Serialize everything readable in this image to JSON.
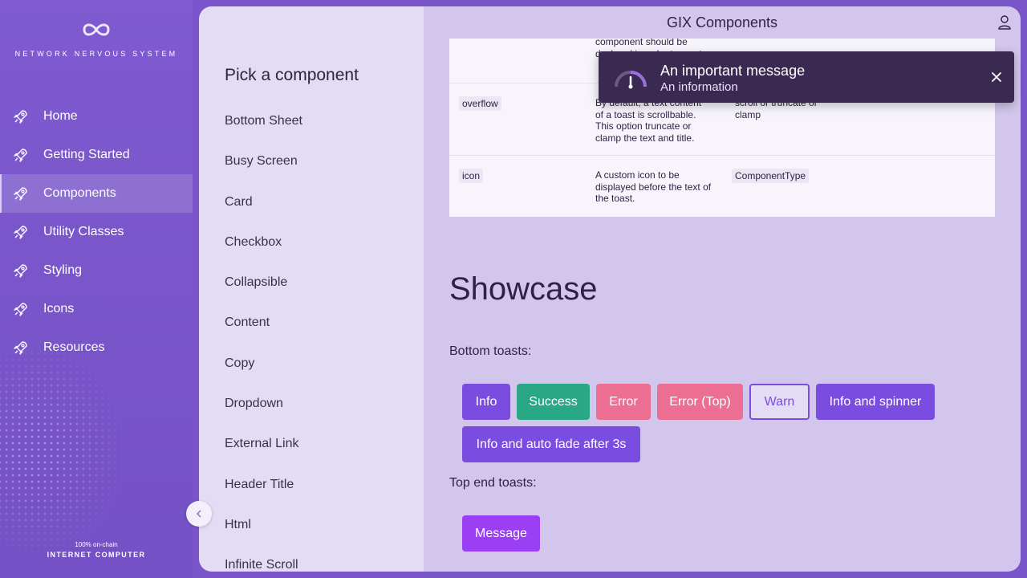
{
  "brand": {
    "name": "NETWORK NERVOUS SYSTEM",
    "footer_line1": "100% on-chain",
    "footer_line2": "INTERNET COMPUTER"
  },
  "nav": {
    "items": [
      {
        "label": "Home",
        "icon": "rocket-icon",
        "active": false
      },
      {
        "label": "Getting Started",
        "icon": "rocket-icon",
        "active": false
      },
      {
        "label": "Components",
        "icon": "rocket-icon",
        "active": true
      },
      {
        "label": "Utility Classes",
        "icon": "rocket-icon",
        "active": false
      },
      {
        "label": "Styling",
        "icon": "rocket-icon",
        "active": false
      },
      {
        "label": "Icons",
        "icon": "rocket-icon",
        "active": false
      },
      {
        "label": "Resources",
        "icon": "rocket-icon",
        "active": false
      }
    ]
  },
  "header": {
    "title": "GIX Components"
  },
  "picker": {
    "title": "Pick a component",
    "items": [
      "Bottom Sheet",
      "Busy Screen",
      "Card",
      "Checkbox",
      "Collapsible",
      "Content",
      "Copy",
      "Dropdown",
      "External Link",
      "Header Title",
      "Html",
      "Infinite Scroll"
    ]
  },
  "table": {
    "rows": [
      {
        "prop": "",
        "description": "component should be declared in order to use t...",
        "type": ""
      },
      {
        "prop": "overflow",
        "description": "By default, a text content of a toast is scrollbable. This option truncate or clamp the text and title.",
        "type": "scroll or truncate or clamp"
      },
      {
        "prop": "icon",
        "description": "A custom icon to be displayed before the text of the toast.",
        "type": "ComponentType"
      }
    ]
  },
  "showcase": {
    "title": "Showcase",
    "bottom_label": "Bottom toasts:",
    "top_label": "Top end toasts:",
    "bottom_buttons": [
      "Info",
      "Success",
      "Error",
      "Error (Top)",
      "Warn",
      "Info and spinner",
      "Info and auto fade after 3s"
    ],
    "top_buttons": [
      "Message"
    ]
  },
  "toast": {
    "title": "An important message",
    "message": "An information",
    "icon": "gauge-icon"
  },
  "colors": {
    "nav_bg": "#7a55c9",
    "primary": "#7b4ce0",
    "success": "#2aa784",
    "error": "#ec6f93",
    "toast_bg": "#3a2a52"
  }
}
